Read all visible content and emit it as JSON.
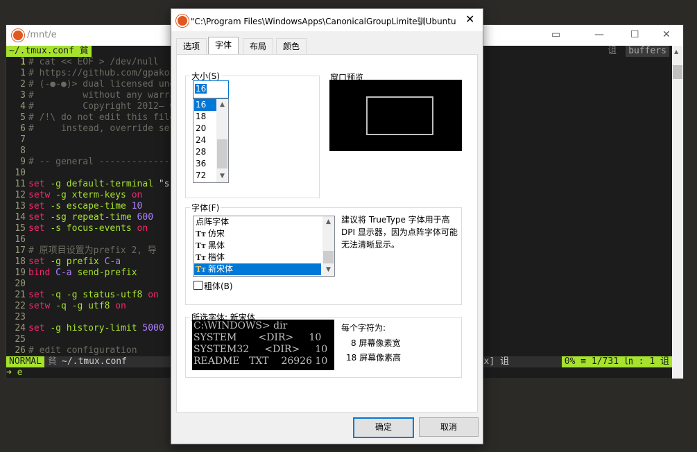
{
  "terminal": {
    "title": "/mnt/e",
    "tab_file": "~/.tmux.conf 貧",
    "buffers_label": "buffers",
    "buffers_glyph": "诅",
    "lines": [
      {
        "n": "1",
        "segs": [
          [
            "cm",
            "# cat << EOF > /dev/null"
          ]
        ],
        "cur": true
      },
      {
        "n": "1",
        "segs": [
          [
            "cm",
            "# https://github.com/gpakosz/.tmux"
          ]
        ]
      },
      {
        "n": "2",
        "segs": [
          [
            "cm",
            "# (-●-●)> dual licensed under"
          ]
        ]
      },
      {
        "n": "3",
        "segs": [
          [
            "cm",
            "#         without any warranty."
          ]
        ]
      },
      {
        "n": "4",
        "segs": [
          [
            "cm",
            "#         Copyright 2012— Gregory"
          ]
        ]
      },
      {
        "n": "5",
        "segs": [
          [
            "cm",
            "# /!\\ do not edit this file"
          ]
        ]
      },
      {
        "n": "6",
        "segs": [
          [
            "cm",
            "#     instead, override settings"
          ]
        ]
      },
      {
        "n": "7",
        "segs": []
      },
      {
        "n": "8",
        "segs": []
      },
      {
        "n": "9",
        "segs": [
          [
            "cm",
            "# -- general -------------------"
          ]
        ]
      },
      {
        "n": "10",
        "segs": []
      },
      {
        "n": "11",
        "segs": [
          [
            "kw",
            "set "
          ],
          [
            "fn",
            "-g default-terminal "
          ],
          [
            "df",
            "\"s"
          ]
        ]
      },
      {
        "n": "12",
        "segs": [
          [
            "kw",
            "setw "
          ],
          [
            "fn",
            "-g xterm-keys "
          ],
          [
            "kw",
            "on"
          ]
        ]
      },
      {
        "n": "13",
        "segs": [
          [
            "kw",
            "set "
          ],
          [
            "fn",
            "-s escape-time "
          ],
          [
            "nm",
            "10"
          ]
        ]
      },
      {
        "n": "14",
        "segs": [
          [
            "kw",
            "set "
          ],
          [
            "fn",
            "-sg repeat-time "
          ],
          [
            "nm",
            "600"
          ]
        ]
      },
      {
        "n": "15",
        "segs": [
          [
            "kw",
            "set "
          ],
          [
            "fn",
            "-s focus-events "
          ],
          [
            "kw",
            "on"
          ]
        ]
      },
      {
        "n": "16",
        "segs": []
      },
      {
        "n": "17",
        "segs": [
          [
            "cm",
            "# 原项目设置为prefix 2, 导"
          ]
        ]
      },
      {
        "n": "18",
        "segs": [
          [
            "kw",
            "set "
          ],
          [
            "fn",
            "-g prefix "
          ],
          [
            "nm",
            "C-a"
          ]
        ]
      },
      {
        "n": "19",
        "segs": [
          [
            "kw",
            "bind "
          ],
          [
            "nm",
            "C-a "
          ],
          [
            "fn",
            "send-prefix"
          ]
        ]
      },
      {
        "n": "20",
        "segs": []
      },
      {
        "n": "21",
        "segs": [
          [
            "kw",
            "set "
          ],
          [
            "fn",
            "-q -g status-utf8 "
          ],
          [
            "kw",
            "on"
          ]
        ]
      },
      {
        "n": "22",
        "segs": [
          [
            "kw",
            "setw "
          ],
          [
            "fn",
            "-q -g utf8 "
          ],
          [
            "kw",
            "on"
          ]
        ]
      },
      {
        "n": "23",
        "segs": []
      },
      {
        "n": "24",
        "segs": [
          [
            "kw",
            "set "
          ],
          [
            "fn",
            "-g history-limit "
          ],
          [
            "nm",
            "5000"
          ]
        ]
      },
      {
        "n": "25",
        "segs": []
      },
      {
        "n": "26",
        "segs": [
          [
            "cm",
            "# edit configuration"
          ]
        ]
      }
    ],
    "status": {
      "mode": "NORMAL",
      "mode_glyph": "貧",
      "file": "~/.tmux.conf",
      "filetype": "nix] 诅",
      "position": "0% ≡   1/731 ㏑ :  1 诅"
    },
    "cmd_prompt": "➜  e"
  },
  "dialog": {
    "title": "\"C:\\Program Files\\WindowsApps\\CanonicalGroupLimite\u0000\u0000Ubuntu",
    "title_display": "\"C:\\Program Files\\WindowsApps\\CanonicalGroupLimite驯Ubuntu",
    "tabs": [
      "选项",
      "字体",
      "布局",
      "颜色"
    ],
    "size_group": {
      "legend": "大小(S)",
      "input_value": "16",
      "sizes": [
        "16",
        "18",
        "20",
        "24",
        "28",
        "36",
        "72"
      ],
      "selected": "16"
    },
    "window_preview_label": "窗口预览",
    "font_group": {
      "legend": "字体(F)",
      "fonts": [
        "点阵字体",
        "仿宋",
        "黑体",
        "楷体",
        "新宋体"
      ],
      "selected": "新宋体",
      "bold_label": "粗体(B)",
      "hint": "建议将 TrueType 字体用于高 DPI 显示器，因为点阵字体可能无法清晰显示。"
    },
    "selected_font_group": {
      "legend": "所选字体: 新宋体",
      "sample_lines": [
        "C:\\WINDOWS> dir",
        "SYSTEM       <DIR>     10",
        "SYSTEM32     <DIR>     10",
        "README   TXT    26926 10"
      ],
      "char_is": "每个字符为:",
      "width": "8 屏幕像素宽",
      "height": "18 屏幕像素高"
    },
    "ok_label": "确定",
    "cancel_label": "取消"
  }
}
